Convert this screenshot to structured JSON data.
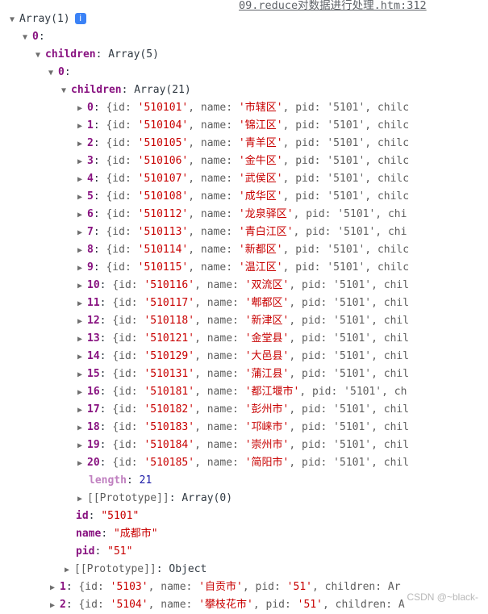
{
  "source_link": "09.reduce对数据进行处理.htm:312",
  "root_label": "Array(1)",
  "info_icon": "i",
  "level0_index": "0",
  "children_key": "children",
  "level1_label": "Array(5)",
  "level1_index": "0",
  "level2_label": "Array(21)",
  "districts": [
    {
      "i": "0",
      "id": "510101",
      "name": "市辖区",
      "tail": ", pid: '5101', chilc"
    },
    {
      "i": "1",
      "id": "510104",
      "name": "锦江区",
      "tail": ", pid: '5101', chilc"
    },
    {
      "i": "2",
      "id": "510105",
      "name": "青羊区",
      "tail": ", pid: '5101', chilc"
    },
    {
      "i": "3",
      "id": "510106",
      "name": "金牛区",
      "tail": ", pid: '5101', chilc"
    },
    {
      "i": "4",
      "id": "510107",
      "name": "武侯区",
      "tail": ", pid: '5101', chilc"
    },
    {
      "i": "5",
      "id": "510108",
      "name": "成华区",
      "tail": ", pid: '5101', chilc"
    },
    {
      "i": "6",
      "id": "510112",
      "name": "龙泉驿区",
      "tail": ", pid: '5101', chi"
    },
    {
      "i": "7",
      "id": "510113",
      "name": "青白江区",
      "tail": ", pid: '5101', chi"
    },
    {
      "i": "8",
      "id": "510114",
      "name": "新都区",
      "tail": ", pid: '5101', chilc"
    },
    {
      "i": "9",
      "id": "510115",
      "name": "温江区",
      "tail": ", pid: '5101', chilc"
    },
    {
      "i": "10",
      "id": "510116",
      "name": "双流区",
      "tail": ", pid: '5101', chil"
    },
    {
      "i": "11",
      "id": "510117",
      "name": "郫都区",
      "tail": ", pid: '5101', chil"
    },
    {
      "i": "12",
      "id": "510118",
      "name": "新津区",
      "tail": ", pid: '5101', chil"
    },
    {
      "i": "13",
      "id": "510121",
      "name": "金堂县",
      "tail": ", pid: '5101', chil"
    },
    {
      "i": "14",
      "id": "510129",
      "name": "大邑县",
      "tail": ", pid: '5101', chil"
    },
    {
      "i": "15",
      "id": "510131",
      "name": "蒲江县",
      "tail": ", pid: '5101', chil"
    },
    {
      "i": "16",
      "id": "510181",
      "name": "都江堰市",
      "tail": ", pid: '5101', ch"
    },
    {
      "i": "17",
      "id": "510182",
      "name": "彭州市",
      "tail": ", pid: '5101', chil"
    },
    {
      "i": "18",
      "id": "510183",
      "name": "邛崃市",
      "tail": ", pid: '5101', chil"
    },
    {
      "i": "19",
      "id": "510184",
      "name": "崇州市",
      "tail": ", pid: '5101', chil"
    },
    {
      "i": "20",
      "id": "510185",
      "name": "简阳市",
      "tail": ", pid: '5101', chil"
    }
  ],
  "length_key": "length",
  "length_value": "21",
  "proto_key": "[[Prototype]]",
  "proto_array": "Array(0)",
  "proto_object": "Object",
  "city": {
    "id": "\"5101\"",
    "name": "\"成都市\"",
    "pid": "\"51\""
  },
  "city_keys": {
    "id": "id",
    "name": "name",
    "pid": "pid"
  },
  "siblings": [
    {
      "i": "1",
      "text": "{id: '5103', name: '自贡市', pid: '51', children: Ar"
    },
    {
      "i": "2",
      "text": "{id: '5104', name: '攀枝花市', pid: '51', children: A"
    }
  ],
  "watermark": "CSDN @~black-"
}
